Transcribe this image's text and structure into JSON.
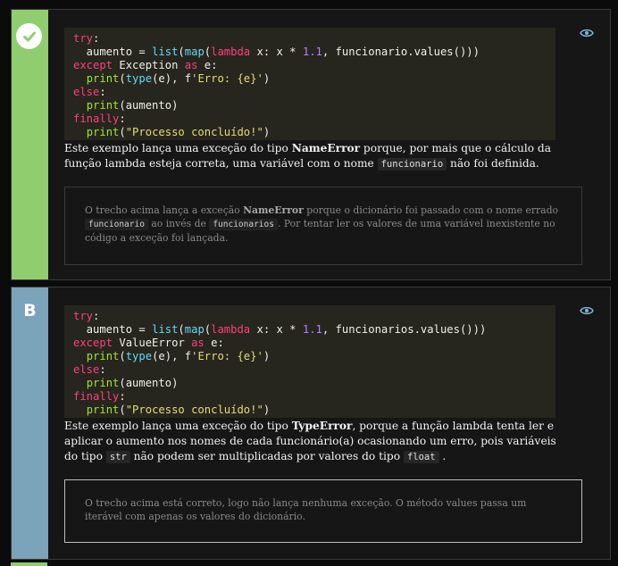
{
  "options": [
    {
      "status": "correct",
      "badge_icon": "check-icon",
      "strip_color": "#8fcd6f",
      "code_lines": [
        "try:",
        "  aumento = list(map(lambda x: x * 1.1, funcionario.values()))",
        "except Exception as e:",
        "  print(type(e), f'Erro: {e}')",
        "else:",
        "  print(aumento)",
        "finally:",
        "  print(\"Processo concluído!\")"
      ],
      "description": {
        "t1": "Este exemplo lança uma exceção do tipo ",
        "b1": "NameError",
        "t2": " porque, por mais que o cálculo da função lambda esteja correta, uma variável com o nome ",
        "c1": "funcionario",
        "t3": " não foi definida."
      },
      "explanation": {
        "t1": "O trecho acima lança a exceção ",
        "b1": "NameError",
        "t2": " porque o dicionário foi passado com o nome errado ",
        "c1": "funcionario",
        "t3": " ao invés de ",
        "c2": "funcionarios",
        "t4": ". Por tentar ler os valores de uma variável inexistente no código a exceção foi lançada."
      }
    },
    {
      "status": "option",
      "letter": "B",
      "strip_color": "#7ba3b9",
      "code_lines": [
        "try:",
        "  aumento = list(map(lambda x: x * 1.1, funcionarios.values()))",
        "except ValueError as e:",
        "  print(type(e), f'Erro: {e}')",
        "else:",
        "  print(aumento)",
        "finally:",
        "  print(\"Processo concluído!\")"
      ],
      "description": {
        "t1": "Este exemplo lança uma exceção do tipo ",
        "b1": "TypeError",
        "t2": ", porque a função lambda tenta ler e aplicar o aumento nos nomes de cada funcionário(a) ocasionando um erro, pois variáveis do tipo ",
        "c1": "str",
        "t3": " não podem ser multiplicadas por valores do tipo ",
        "c2": "float",
        "t4": " ."
      },
      "explanation": {
        "t1": "O trecho acima está correto, logo não lança nenhuma exceção. O método values passa um iterável com apenas os valores do dicionário."
      }
    }
  ],
  "icons": {
    "toggle": "eye-icon"
  }
}
